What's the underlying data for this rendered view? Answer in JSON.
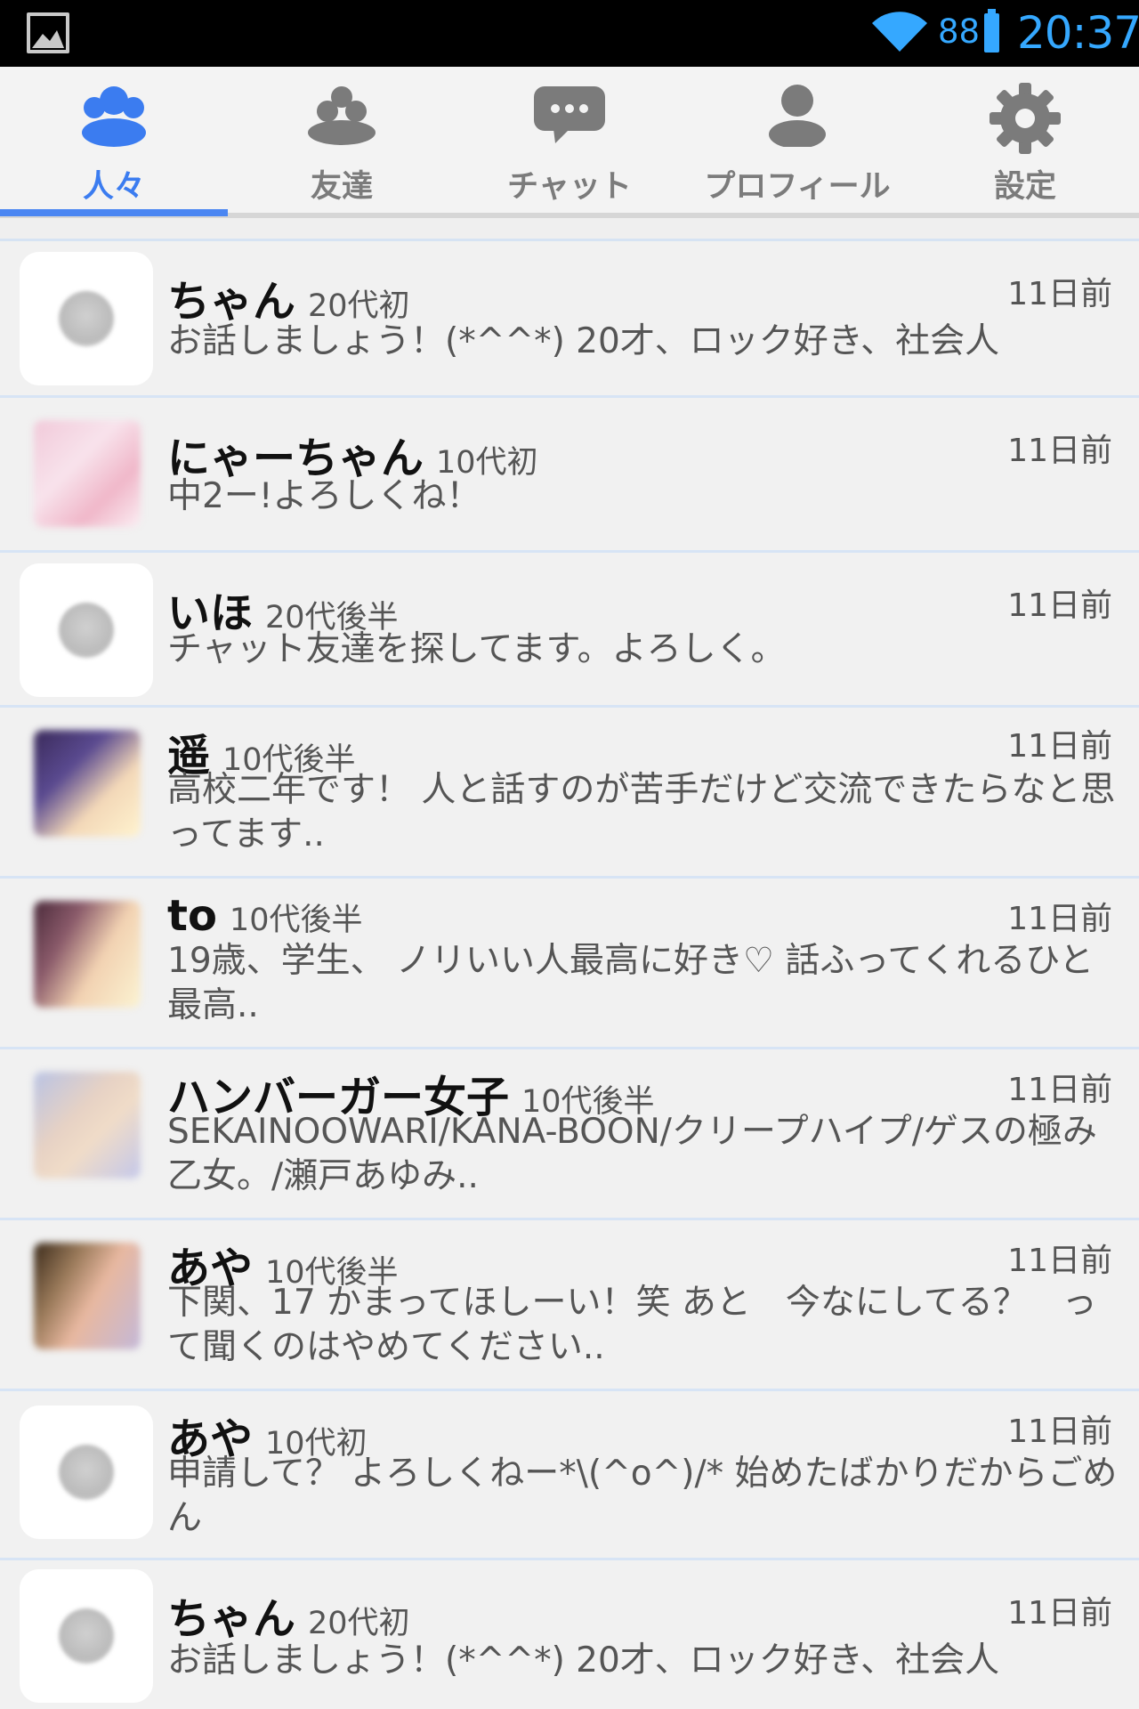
{
  "status_bar": {
    "icons": [
      "image-icon",
      "wifi-icon",
      "battery-icon"
    ],
    "battery_level": "88",
    "time": "20:37",
    "accent_color": "#35a8ff"
  },
  "tabs": [
    {
      "label": "人々",
      "icon": "people-icon",
      "active": true
    },
    {
      "label": "友達",
      "icon": "friends-icon",
      "active": false
    },
    {
      "label": "チャット",
      "icon": "chat-icon",
      "active": false
    },
    {
      "label": "プロフィール",
      "icon": "profile-icon",
      "active": false
    },
    {
      "label": "設定",
      "icon": "gear-icon",
      "active": false
    }
  ],
  "active_tab_color": "#3b7cf0",
  "users": [
    {
      "name": "ちゃん",
      "age": "20代初",
      "time": "11日前",
      "message": "お話しましょう！(*^^*) 20才、ロック好き、社会人"
    },
    {
      "name": "にゃーちゃん",
      "age": "10代初",
      "time": "11日前",
      "message": "中2ー!よろしくね！"
    },
    {
      "name": "いほ",
      "age": "20代後半",
      "time": "11日前",
      "message": "チャット友達を探してます。よろしく。"
    },
    {
      "name": "遥",
      "age": "10代後半",
      "time": "11日前",
      "message": "高校二年です！ 人と話すのが苦手だけど交流できたらなと思ってます.."
    },
    {
      "name": "to",
      "age": "10代後半",
      "time": "11日前",
      "message": "19歳、学生、 ノリいい人最高に好き♡ 話ふってくれるひと最高.."
    },
    {
      "name": "ハンバーガー女子",
      "age": "10代後半",
      "time": "11日前",
      "message": "SEKAINOOWARI/KANA-BOON/クリープハイプ/ゲスの極み乙女。/瀬戸あゆみ.."
    },
    {
      "name": "あや",
      "age": "10代後半",
      "time": "11日前",
      "message": "下関、17 かまってほしーい！笑 あと　今なにしてる？　って聞くのはやめてください.."
    },
    {
      "name": "あや",
      "age": "10代初",
      "time": "11日前",
      "message": "申請して？ よろしくねー*\\(^o^)/* 始めたばかりだからごめん"
    },
    {
      "name": "ちゃん",
      "age": "20代初",
      "time": "11日前",
      "message": "お話しましょう！(*^^*) 20才、ロック好き、社会人"
    }
  ]
}
